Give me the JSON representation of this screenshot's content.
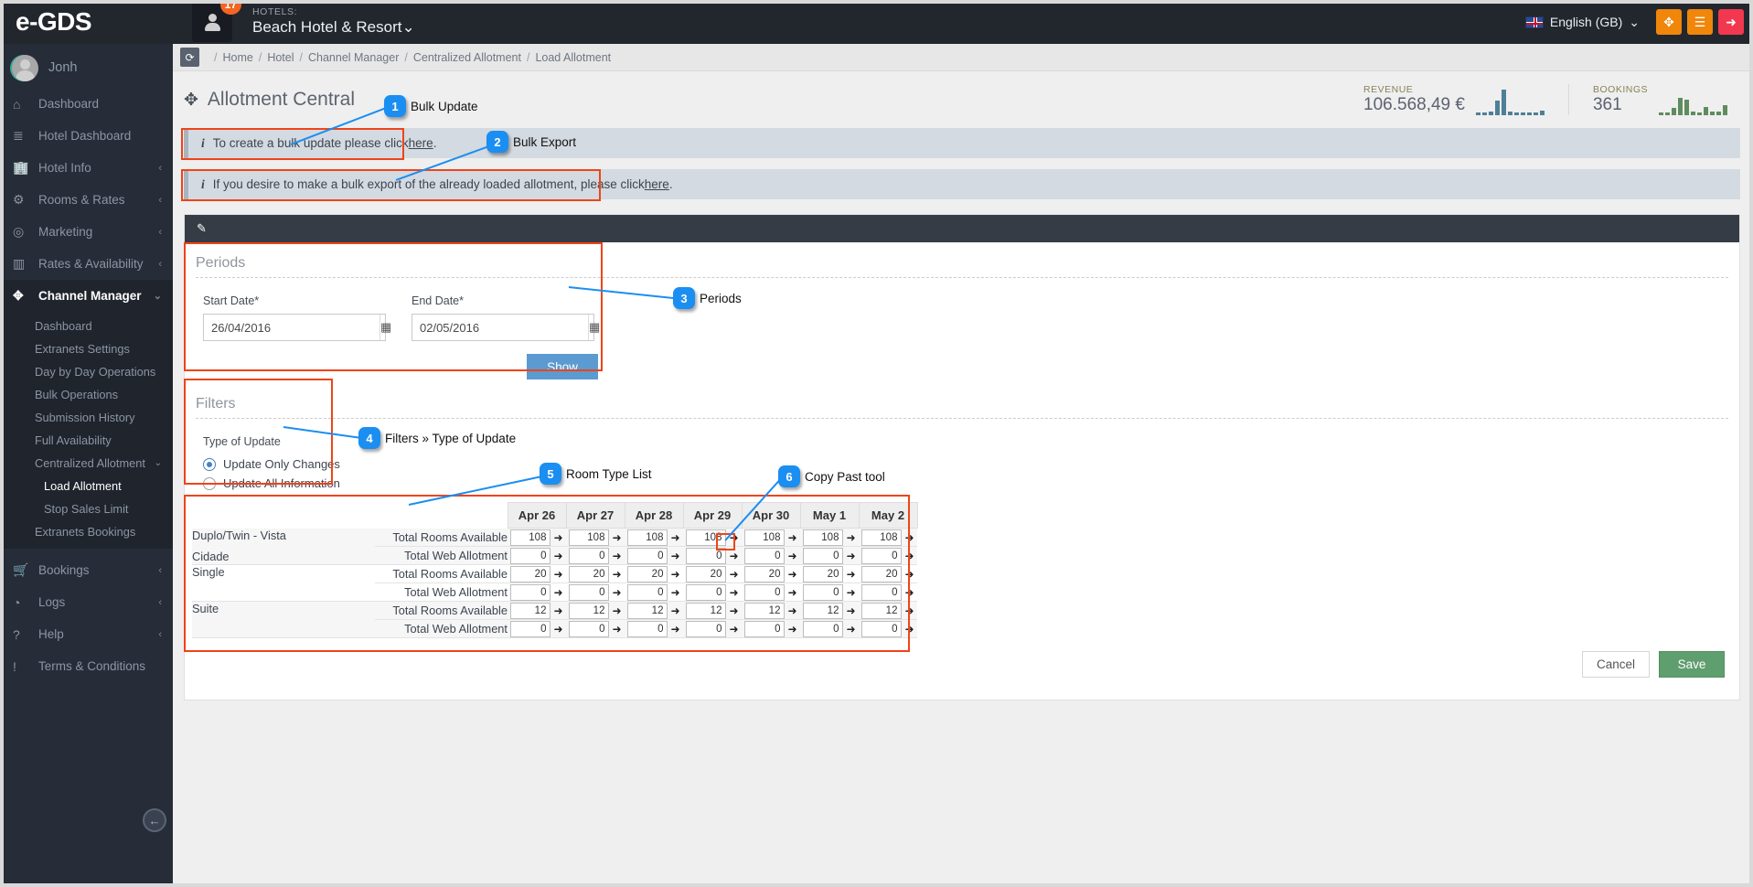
{
  "topbar": {
    "brand": "e-GDS",
    "notification_count": "17",
    "hotels_label": "HOTELS:",
    "hotel_name": "Beach Hotel & Resort",
    "hotel_caret": "⌄",
    "language": "English (GB)",
    "language_caret": "⌄",
    "btn_expand_icon": "✥",
    "btn_menu_icon": "☰",
    "btn_logout_icon": "➜"
  },
  "sidebar": {
    "user": "Jonh",
    "items": [
      {
        "label": "Dashboard",
        "icon": "⌂",
        "caret": ""
      },
      {
        "label": "Hotel Dashboard",
        "icon": "≣",
        "caret": ""
      },
      {
        "label": "Hotel Info",
        "icon": "🏢",
        "caret": "‹"
      },
      {
        "label": "Rooms & Rates",
        "icon": "⚙",
        "caret": "‹"
      },
      {
        "label": "Marketing",
        "icon": "◎",
        "caret": "‹"
      },
      {
        "label": "Rates & Availability",
        "icon": "▥",
        "caret": "‹"
      },
      {
        "label": "Channel Manager",
        "icon": "✥",
        "caret": "⌄"
      }
    ],
    "channel_manager_sub": [
      {
        "label": "Dashboard",
        "level": 1,
        "selected": false
      },
      {
        "label": "Extranets Settings",
        "level": 1,
        "selected": false
      },
      {
        "label": "Day by Day Operations",
        "level": 1,
        "selected": false
      },
      {
        "label": "Bulk Operations",
        "level": 1,
        "selected": false
      },
      {
        "label": "Submission History",
        "level": 1,
        "selected": false
      },
      {
        "label": "Full Availability",
        "level": 1,
        "selected": false
      },
      {
        "label": "Centralized Allotment",
        "level": 1,
        "selected": false,
        "caret": "⌄"
      },
      {
        "label": "Load Allotment",
        "level": 2,
        "selected": true
      },
      {
        "label": "Stop Sales Limit",
        "level": 2,
        "selected": false
      },
      {
        "label": "Extranets Bookings",
        "level": 1,
        "selected": false
      }
    ],
    "items_bottom": [
      {
        "label": "Bookings",
        "icon": "🛒",
        "caret": "‹"
      },
      {
        "label": "Logs",
        "icon": "◔",
        "caret": "‹"
      },
      {
        "label": "Help",
        "icon": "?",
        "caret": "‹"
      },
      {
        "label": "Terms & Conditions",
        "icon": "!",
        "caret": ""
      }
    ],
    "collapse_icon": "←"
  },
  "breadcrumb": {
    "refresh_icon": "⟳",
    "items": [
      "Home",
      "Hotel",
      "Channel Manager",
      "Centralized Allotment",
      "Load Allotment"
    ],
    "separator": "/"
  },
  "page": {
    "title": "Allotment Central",
    "title_icon": "✥"
  },
  "kpis": [
    {
      "label": "REVENUE",
      "value": "106.568,49 €",
      "spark": [
        3,
        3,
        4,
        16,
        28,
        4,
        3,
        3,
        3,
        3,
        5
      ],
      "color": "#4f7f96"
    },
    {
      "label": "BOOKINGS",
      "value": "361",
      "spark": [
        3,
        3,
        8,
        19,
        17,
        4,
        3,
        9,
        4,
        4,
        11
      ],
      "color": "#5f8c5f"
    }
  ],
  "alerts": [
    {
      "icon": "i",
      "text_before": "To create a bulk update please click ",
      "link": "here",
      "text_after": "."
    },
    {
      "icon": "i",
      "text_before": "If you desire to make a bulk export of the already loaded allotment, please click ",
      "link": "here",
      "text_after": "."
    }
  ],
  "panel": {
    "head_icon": "✎"
  },
  "periods": {
    "legend": "Periods",
    "start_label": "Start Date*",
    "start_value": "26/04/2016",
    "end_label": "End Date*",
    "end_value": "02/05/2016",
    "calendar_icon": "▦",
    "show_button": "Show"
  },
  "filters": {
    "legend": "Filters",
    "group_label": "Type of Update",
    "options": [
      {
        "label": "Update Only Changes",
        "selected": true
      },
      {
        "label": "Update All Information",
        "selected": false
      }
    ]
  },
  "allotment": {
    "columns": [
      "Apr 26",
      "Apr 27",
      "Apr 28",
      "Apr 29",
      "Apr 30",
      "May 1",
      "May 2"
    ],
    "arrow_icon": "➜",
    "rows": [
      {
        "room_type": "Duplo/Twin - Vista",
        "room_type_line2": "Cidade",
        "metrics": [
          {
            "label": "Total Rooms Available",
            "values": [
              "108",
              "108",
              "108",
              "108",
              "108",
              "108",
              "108"
            ]
          },
          {
            "label": "Total Web Allotment",
            "values": [
              "0",
              "0",
              "0",
              "0",
              "0",
              "0",
              "0"
            ]
          }
        ]
      },
      {
        "room_type": "Single",
        "room_type_line2": "",
        "metrics": [
          {
            "label": "Total Rooms Available",
            "values": [
              "20",
              "20",
              "20",
              "20",
              "20",
              "20",
              "20"
            ]
          },
          {
            "label": "Total Web Allotment",
            "values": [
              "0",
              "0",
              "0",
              "0",
              "0",
              "0",
              "0"
            ]
          }
        ]
      },
      {
        "room_type": "Suite",
        "room_type_line2": "",
        "metrics": [
          {
            "label": "Total Rooms Available",
            "values": [
              "12",
              "12",
              "12",
              "12",
              "12",
              "12",
              "12"
            ]
          },
          {
            "label": "Total Web Allotment",
            "values": [
              "0",
              "0",
              "0",
              "0",
              "0",
              "0",
              "0"
            ]
          }
        ]
      }
    ]
  },
  "footer": {
    "cancel": "Cancel",
    "save": "Save"
  },
  "annotations": [
    {
      "number": "1",
      "label": "Bulk Update"
    },
    {
      "number": "2",
      "label": "Bulk Export"
    },
    {
      "number": "3",
      "label": "Periods"
    },
    {
      "number": "4",
      "label": "Filters » Type of Update"
    },
    {
      "number": "5",
      "label": "Room Type List"
    },
    {
      "number": "6",
      "label": "Copy Past tool"
    }
  ],
  "colors": {
    "highlight": "#ef4418",
    "callout": "#1b8ef2",
    "accent_orange": "#f0860a",
    "save_green": "#5f9e6e",
    "primary_blue": "#5b9bd1"
  }
}
